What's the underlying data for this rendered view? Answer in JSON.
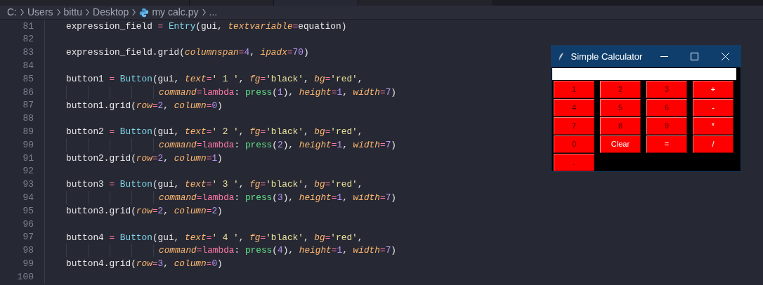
{
  "breadcrumb": [
    {
      "kind": "text",
      "text": "C:"
    },
    {
      "kind": "text",
      "text": "Users"
    },
    {
      "kind": "text",
      "text": "bittu"
    },
    {
      "kind": "text",
      "text": "Desktop"
    },
    {
      "kind": "python-file",
      "text": "my calc.py"
    },
    {
      "kind": "text",
      "text": "..."
    }
  ],
  "editor": {
    "lines": [
      {
        "number": "81",
        "kind": "body",
        "tokens": [
          {
            "kind": "plain",
            "text": "expression_field "
          },
          {
            "kind": "assign",
            "text": "="
          },
          {
            "kind": "cls",
            "text": "Entry"
          },
          {
            "kind": "plain",
            "text": "(gui, "
          },
          {
            "kind": "param",
            "text": "textvariable"
          },
          {
            "kind": "op",
            "text": "="
          },
          {
            "kind": "plain",
            "text": "equation)"
          }
        ]
      },
      {
        "number": "82",
        "kind": "body"
      },
      {
        "number": "83",
        "kind": "body",
        "tokens": [
          {
            "kind": "plain",
            "text": "expression_field.grid("
          },
          {
            "kind": "param",
            "text": "columnspan"
          },
          {
            "kind": "op",
            "text": "="
          },
          {
            "kind": "num",
            "text": "4"
          },
          {
            "kind": "plain",
            "text": ", "
          },
          {
            "kind": "param",
            "text": "ipadx"
          },
          {
            "kind": "op",
            "text": "="
          },
          {
            "kind": "num",
            "text": "70"
          },
          {
            "kind": "plain",
            "text": ")"
          }
        ]
      },
      {
        "number": "84",
        "kind": "body"
      },
      {
        "number": "85",
        "kind": "body",
        "tokens": [
          {
            "kind": "plain",
            "text": "button1 "
          },
          {
            "kind": "assign",
            "text": "="
          },
          {
            "kind": "cls",
            "text": "Button"
          },
          {
            "kind": "plain",
            "text": "(gui, "
          },
          {
            "kind": "param",
            "text": "text"
          },
          {
            "kind": "op",
            "text": "="
          },
          {
            "kind": "str",
            "text": "' 1 '"
          },
          {
            "kind": "plain",
            "text": ", "
          },
          {
            "kind": "param",
            "text": "fg"
          },
          {
            "kind": "op",
            "text": "="
          },
          {
            "kind": "str",
            "text": "'black'"
          },
          {
            "kind": "plain",
            "text": ", "
          },
          {
            "kind": "param",
            "text": "bg"
          },
          {
            "kind": "op",
            "text": "="
          },
          {
            "kind": "str",
            "text": "'red'"
          },
          {
            "kind": "plain",
            "text": ","
          }
        ]
      },
      {
        "number": "86",
        "kind": "continuation",
        "tokens": [
          {
            "kind": "param",
            "text": "command"
          },
          {
            "kind": "op",
            "text": "="
          },
          {
            "kind": "kw",
            "text": "lambda"
          },
          {
            "kind": "plain",
            "text": ": "
          },
          {
            "kind": "fn",
            "text": "press"
          },
          {
            "kind": "plain",
            "text": "("
          },
          {
            "kind": "num",
            "text": "1"
          },
          {
            "kind": "plain",
            "text": "), "
          },
          {
            "kind": "param",
            "text": "height"
          },
          {
            "kind": "op",
            "text": "="
          },
          {
            "kind": "num",
            "text": "1"
          },
          {
            "kind": "plain",
            "text": ", "
          },
          {
            "kind": "param",
            "text": "width"
          },
          {
            "kind": "op",
            "text": "="
          },
          {
            "kind": "num",
            "text": "7"
          },
          {
            "kind": "plain",
            "text": ")"
          }
        ]
      },
      {
        "number": "87",
        "kind": "body",
        "tokens": [
          {
            "kind": "plain",
            "text": "button1.grid("
          },
          {
            "kind": "param",
            "text": "row"
          },
          {
            "kind": "op",
            "text": "="
          },
          {
            "kind": "num",
            "text": "2"
          },
          {
            "kind": "plain",
            "text": ", "
          },
          {
            "kind": "param",
            "text": "column"
          },
          {
            "kind": "op",
            "text": "="
          },
          {
            "kind": "num",
            "text": "0"
          },
          {
            "kind": "plain",
            "text": ")"
          }
        ]
      },
      {
        "number": "88",
        "kind": "body"
      },
      {
        "number": "89",
        "kind": "body",
        "tokens": [
          {
            "kind": "plain",
            "text": "button2 "
          },
          {
            "kind": "assign",
            "text": "="
          },
          {
            "kind": "cls",
            "text": "Button"
          },
          {
            "kind": "plain",
            "text": "(gui, "
          },
          {
            "kind": "param",
            "text": "text"
          },
          {
            "kind": "op",
            "text": "="
          },
          {
            "kind": "str",
            "text": "' 2 '"
          },
          {
            "kind": "plain",
            "text": ", "
          },
          {
            "kind": "param",
            "text": "fg"
          },
          {
            "kind": "op",
            "text": "="
          },
          {
            "kind": "str",
            "text": "'black'"
          },
          {
            "kind": "plain",
            "text": ", "
          },
          {
            "kind": "param",
            "text": "bg"
          },
          {
            "kind": "op",
            "text": "="
          },
          {
            "kind": "str",
            "text": "'red'"
          },
          {
            "kind": "plain",
            "text": ","
          }
        ]
      },
      {
        "number": "90",
        "kind": "continuation",
        "tokens": [
          {
            "kind": "param",
            "text": "command"
          },
          {
            "kind": "op",
            "text": "="
          },
          {
            "kind": "kw",
            "text": "lambda"
          },
          {
            "kind": "plain",
            "text": ": "
          },
          {
            "kind": "fn",
            "text": "press"
          },
          {
            "kind": "plain",
            "text": "("
          },
          {
            "kind": "num",
            "text": "2"
          },
          {
            "kind": "plain",
            "text": "), "
          },
          {
            "kind": "param",
            "text": "height"
          },
          {
            "kind": "op",
            "text": "="
          },
          {
            "kind": "num",
            "text": "1"
          },
          {
            "kind": "plain",
            "text": ", "
          },
          {
            "kind": "param",
            "text": "width"
          },
          {
            "kind": "op",
            "text": "="
          },
          {
            "kind": "num",
            "text": "7"
          },
          {
            "kind": "plain",
            "text": ")"
          }
        ]
      },
      {
        "number": "91",
        "kind": "body",
        "tokens": [
          {
            "kind": "plain",
            "text": "button2.grid("
          },
          {
            "kind": "param",
            "text": "row"
          },
          {
            "kind": "op",
            "text": "="
          },
          {
            "kind": "num",
            "text": "2"
          },
          {
            "kind": "plain",
            "text": ", "
          },
          {
            "kind": "param",
            "text": "column"
          },
          {
            "kind": "op",
            "text": "="
          },
          {
            "kind": "num",
            "text": "1"
          },
          {
            "kind": "plain",
            "text": ")"
          }
        ]
      },
      {
        "number": "92",
        "kind": "body"
      },
      {
        "number": "93",
        "kind": "body",
        "tokens": [
          {
            "kind": "plain",
            "text": "button3 "
          },
          {
            "kind": "assign",
            "text": "="
          },
          {
            "kind": "cls",
            "text": "Button"
          },
          {
            "kind": "plain",
            "text": "(gui, "
          },
          {
            "kind": "param",
            "text": "text"
          },
          {
            "kind": "op",
            "text": "="
          },
          {
            "kind": "str",
            "text": "' 3 '"
          },
          {
            "kind": "plain",
            "text": ", "
          },
          {
            "kind": "param",
            "text": "fg"
          },
          {
            "kind": "op",
            "text": "="
          },
          {
            "kind": "str",
            "text": "'black'"
          },
          {
            "kind": "plain",
            "text": ", "
          },
          {
            "kind": "param",
            "text": "bg"
          },
          {
            "kind": "op",
            "text": "="
          },
          {
            "kind": "str",
            "text": "'red'"
          },
          {
            "kind": "plain",
            "text": ","
          }
        ]
      },
      {
        "number": "94",
        "kind": "continuation",
        "tokens": [
          {
            "kind": "param",
            "text": "command"
          },
          {
            "kind": "op",
            "text": "="
          },
          {
            "kind": "kw",
            "text": "lambda"
          },
          {
            "kind": "plain",
            "text": ": "
          },
          {
            "kind": "fn",
            "text": "press"
          },
          {
            "kind": "plain",
            "text": "("
          },
          {
            "kind": "num",
            "text": "3"
          },
          {
            "kind": "plain",
            "text": "), "
          },
          {
            "kind": "param",
            "text": "height"
          },
          {
            "kind": "op",
            "text": "="
          },
          {
            "kind": "num",
            "text": "1"
          },
          {
            "kind": "plain",
            "text": ", "
          },
          {
            "kind": "param",
            "text": "width"
          },
          {
            "kind": "op",
            "text": "="
          },
          {
            "kind": "num",
            "text": "7"
          },
          {
            "kind": "plain",
            "text": ")"
          }
        ]
      },
      {
        "number": "95",
        "kind": "body",
        "tokens": [
          {
            "kind": "plain",
            "text": "button3.grid("
          },
          {
            "kind": "param",
            "text": "row"
          },
          {
            "kind": "op",
            "text": "="
          },
          {
            "kind": "num",
            "text": "2"
          },
          {
            "kind": "plain",
            "text": ", "
          },
          {
            "kind": "param",
            "text": "column"
          },
          {
            "kind": "op",
            "text": "="
          },
          {
            "kind": "num",
            "text": "2"
          },
          {
            "kind": "plain",
            "text": ")"
          }
        ]
      },
      {
        "number": "96",
        "kind": "body"
      },
      {
        "number": "97",
        "kind": "body",
        "tokens": [
          {
            "kind": "plain",
            "text": "button4 "
          },
          {
            "kind": "assign",
            "text": "="
          },
          {
            "kind": "cls",
            "text": "Button"
          },
          {
            "kind": "plain",
            "text": "(gui, "
          },
          {
            "kind": "param",
            "text": "text"
          },
          {
            "kind": "op",
            "text": "="
          },
          {
            "kind": "str",
            "text": "' 4 '"
          },
          {
            "kind": "plain",
            "text": ", "
          },
          {
            "kind": "param",
            "text": "fg"
          },
          {
            "kind": "op",
            "text": "="
          },
          {
            "kind": "str",
            "text": "'black'"
          },
          {
            "kind": "plain",
            "text": ", "
          },
          {
            "kind": "param",
            "text": "bg"
          },
          {
            "kind": "op",
            "text": "="
          },
          {
            "kind": "str",
            "text": "'red'"
          },
          {
            "kind": "plain",
            "text": ","
          }
        ]
      },
      {
        "number": "98",
        "kind": "continuation",
        "tokens": [
          {
            "kind": "param",
            "text": "command"
          },
          {
            "kind": "op",
            "text": "="
          },
          {
            "kind": "kw",
            "text": "lambda"
          },
          {
            "kind": "plain",
            "text": ": "
          },
          {
            "kind": "fn",
            "text": "press"
          },
          {
            "kind": "plain",
            "text": "("
          },
          {
            "kind": "num",
            "text": "4"
          },
          {
            "kind": "plain",
            "text": "), "
          },
          {
            "kind": "param",
            "text": "height"
          },
          {
            "kind": "op",
            "text": "="
          },
          {
            "kind": "num",
            "text": "1"
          },
          {
            "kind": "plain",
            "text": ", "
          },
          {
            "kind": "param",
            "text": "width"
          },
          {
            "kind": "op",
            "text": "="
          },
          {
            "kind": "num",
            "text": "7"
          },
          {
            "kind": "plain",
            "text": ")"
          }
        ]
      },
      {
        "number": "99",
        "kind": "body",
        "tokens": [
          {
            "kind": "plain",
            "text": "button4.grid("
          },
          {
            "kind": "param",
            "text": "row"
          },
          {
            "kind": "op",
            "text": "="
          },
          {
            "kind": "num",
            "text": "3"
          },
          {
            "kind": "plain",
            "text": ", "
          },
          {
            "kind": "param",
            "text": "column"
          },
          {
            "kind": "op",
            "text": "="
          },
          {
            "kind": "num",
            "text": "0"
          },
          {
            "kind": "plain",
            "text": ")"
          }
        ]
      },
      {
        "number": "100",
        "kind": "body"
      }
    ]
  },
  "calculator": {
    "title": "Simple Calculator",
    "buttons": [
      {
        "label": "1",
        "kind": "digit"
      },
      {
        "label": "2",
        "kind": "digit"
      },
      {
        "label": "3",
        "kind": "digit"
      },
      {
        "label": "+",
        "kind": "op"
      },
      {
        "label": "4",
        "kind": "digit"
      },
      {
        "label": "5",
        "kind": "digit"
      },
      {
        "label": "6",
        "kind": "digit"
      },
      {
        "label": "-",
        "kind": "op"
      },
      {
        "label": "7",
        "kind": "digit"
      },
      {
        "label": "8",
        "kind": "digit"
      },
      {
        "label": "9",
        "kind": "digit"
      },
      {
        "label": "*",
        "kind": "op"
      },
      {
        "label": "0",
        "kind": "digit"
      },
      {
        "label": "Clear",
        "kind": "op"
      },
      {
        "label": "=",
        "kind": "op"
      },
      {
        "label": "/",
        "kind": "op"
      },
      {
        "label": ".",
        "kind": "digit"
      }
    ]
  }
}
